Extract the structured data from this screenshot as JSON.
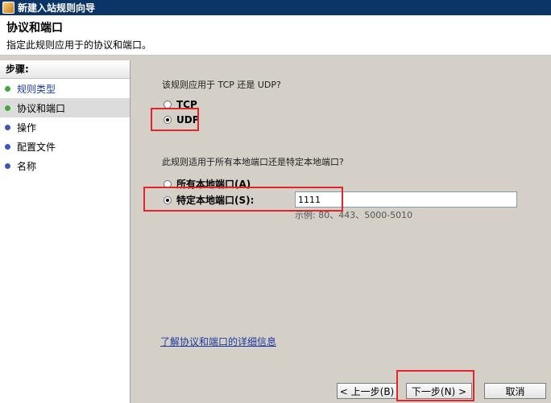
{
  "window": {
    "title": "新建入站规则向导",
    "icon": "app-icon"
  },
  "header": {
    "title": "协议和端口",
    "subtitle": "指定此规则应用于的协议和端口。"
  },
  "sidebar": {
    "heading": "步骤:",
    "items": [
      {
        "label": "规则类型",
        "state": "done"
      },
      {
        "label": "协议和端口",
        "state": "active"
      },
      {
        "label": "操作",
        "state": "todo"
      },
      {
        "label": "配置文件",
        "state": "todo"
      },
      {
        "label": "名称",
        "state": "todo"
      }
    ]
  },
  "protocol": {
    "question": "该规则应用于 TCP 还是 UDP?",
    "options": [
      "TCP",
      "UDP"
    ],
    "selected": "UDP"
  },
  "ports": {
    "question": "此规则适用于所有本地端口还是特定本地端口?",
    "all_label": "所有本地端口(A)",
    "specific_label": "特定本地端口(S):",
    "selected": "specific",
    "value": "1111",
    "example": "示例: 80、443、5000-5010"
  },
  "link": {
    "text": "了解协议和端口的详细信息"
  },
  "buttons": {
    "back": "< 上一步(B)",
    "next": "下一步(N) >",
    "cancel": "取消"
  },
  "colors": {
    "titlebar": "#0c3567",
    "highlight": "#e3242b",
    "link": "#1d3a9c",
    "done": "#42a83b",
    "todo": "#3b56b8"
  }
}
